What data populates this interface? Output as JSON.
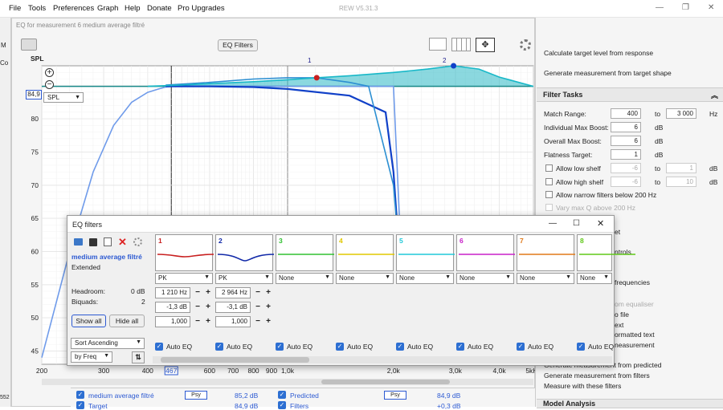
{
  "menu": {
    "items": [
      "File",
      "Tools",
      "Preferences",
      "Graph",
      "Help",
      "Donate",
      "Pro Upgrades"
    ]
  },
  "app": {
    "title": "REW V5.31.3"
  },
  "eq_window": {
    "title": "EQ for measurement 6 medium average filtré",
    "eq_filters_button": "EQ Filters",
    "spl_label": "SPL",
    "spl_value": "84,9",
    "spl_select": "SPL",
    "marker1": "1",
    "marker2": "2"
  },
  "left_strip": {
    "m": "M",
    "co": "Co",
    "v": "552"
  },
  "chart_data": {
    "type": "line",
    "xlabel": "",
    "ylabel": "",
    "x_ticks": [
      "200",
      "300",
      "400",
      "467",
      "600",
      "700",
      "800",
      "900",
      "1,0k",
      "2,0k",
      "3,0k",
      "4,0k",
      "5kHz"
    ],
    "x_cursor": "467",
    "y_ticks": [
      "80",
      "75",
      "70",
      "65",
      "60",
      "55",
      "50",
      "45"
    ],
    "xlim": [
      200,
      5000
    ],
    "ylim": [
      43,
      88
    ],
    "log_x": true,
    "target_level": 84.9,
    "series": [
      {
        "color": "#6f9bea",
        "x": [
          200,
          240,
          280,
          320,
          360,
          400,
          430,
          450,
          470,
          500,
          600,
          800,
          1000,
          1500,
          2000,
          2100,
          2200
        ],
        "y": [
          44,
          60,
          72,
          79,
          82.5,
          84,
          84.5,
          84.8,
          84.9,
          84.9,
          84.9,
          84.9,
          84.9,
          84.9,
          84.9,
          60,
          44
        ]
      },
      {
        "color": "#1040c8",
        "x": [
          450,
          600,
          800,
          1000,
          1500,
          1900,
          2000,
          2100,
          2150
        ],
        "y": [
          84.9,
          84.9,
          84.8,
          84.5,
          83.5,
          81,
          72,
          56,
          44
        ]
      },
      {
        "color": "#2c8fd2",
        "x": [
          450,
          600,
          800,
          1000,
          1210,
          1500,
          1700,
          2000,
          2200
        ],
        "y": [
          85.1,
          85.5,
          86,
          86.2,
          86.2,
          85.5,
          84.9,
          70,
          44
        ]
      },
      {
        "color": "#18b8c8",
        "x": [
          400,
          500,
          600,
          800,
          1000,
          1210,
          1500,
          2000,
          2500,
          2964,
          3500,
          4000,
          5000
        ],
        "y": [
          84.9,
          85.1,
          85.3,
          85.6,
          85.9,
          86.2,
          86.5,
          87,
          87.5,
          88,
          87.5,
          86.3,
          84.9
        ]
      }
    ],
    "markers": [
      {
        "x": 1210,
        "y": 86.2,
        "color": "#c81e1e"
      },
      {
        "x": 2964,
        "y": 88,
        "color": "#1040c8"
      }
    ]
  },
  "right_panel": {
    "calc_target": "Calculate target level from response",
    "gen_measurement": "Generate measurement from target shape",
    "filter_tasks_title": "Filter Tasks",
    "match_range_label": "Match Range:",
    "match_range_from": "400",
    "match_range_to_label": "to",
    "match_range_to": "3 000",
    "hz": "Hz",
    "ind_max_boost_label": "Individual Max Boost:",
    "ind_max_boost": "6",
    "overall_max_boost_label": "Overall Max Boost:",
    "overall_max_boost": "6",
    "flatness_label": "Flatness Target:",
    "flatness": "1",
    "db": "dB",
    "allow_low_shelf": "Allow low shelf",
    "low_shelf_from": "-6",
    "low_shelf_to": "1",
    "allow_high_shelf": "Allow high shelf",
    "high_shelf_from": "-6",
    "high_shelf_to": "10",
    "allow_narrow": "Allow narrow filters below 200 Hz",
    "vary_max_q": "Vary max Q above 200 Hz",
    "frag": [
      "et",
      "ntrols",
      "frequencies",
      "om equaliser",
      "o file",
      "ext",
      "ormatted text",
      "neasurement"
    ],
    "gen_from_predicted": "Generate measurement from predicted",
    "gen_from_filters": "Generate measurement from filters",
    "measure_with_filters": "Measure with these filters",
    "model_analysis": "Model Analysis"
  },
  "dialog": {
    "title": "EQ filters",
    "measurement_name": "medium average filtré",
    "mode": "Extended",
    "headroom_label": "Headroom:",
    "headroom": "0 dB",
    "biquads_label": "Biquads:",
    "biquads": "2",
    "show_all": "Show all",
    "hide_all": "Hide all",
    "sort_select": "Sort Ascending",
    "by_freq_select": "by Freq",
    "auto_eq": "Auto EQ",
    "filters": [
      {
        "num": "1",
        "color": "#c81e1e",
        "type": "PK",
        "freq": "1 210 Hz",
        "gain": "-1,3 dB",
        "q": "1,000"
      },
      {
        "num": "2",
        "color": "#1028a8",
        "type": "PK",
        "freq": "2 964 Hz",
        "gain": "-3,1 dB",
        "q": "1,000"
      },
      {
        "num": "3",
        "color": "#30c030",
        "type": "None"
      },
      {
        "num": "4",
        "color": "#e0c800",
        "type": "None"
      },
      {
        "num": "5",
        "color": "#20c8d8",
        "type": "None"
      },
      {
        "num": "6",
        "color": "#c820c8",
        "type": "None"
      },
      {
        "num": "7",
        "color": "#e07818",
        "type": "None"
      },
      {
        "num": "8",
        "color": "#60c818",
        "type": "None"
      }
    ]
  },
  "bottom": {
    "row1_name": "medium average filtré",
    "psy": "Psy",
    "row1_val": "85,2 dB",
    "predicted": "Predicted",
    "predicted_val": "84,9 dB",
    "row2_name": "Target",
    "row2_val": "84,9 dB",
    "filters": "Filters",
    "filters_val": "+0,3 dB"
  }
}
